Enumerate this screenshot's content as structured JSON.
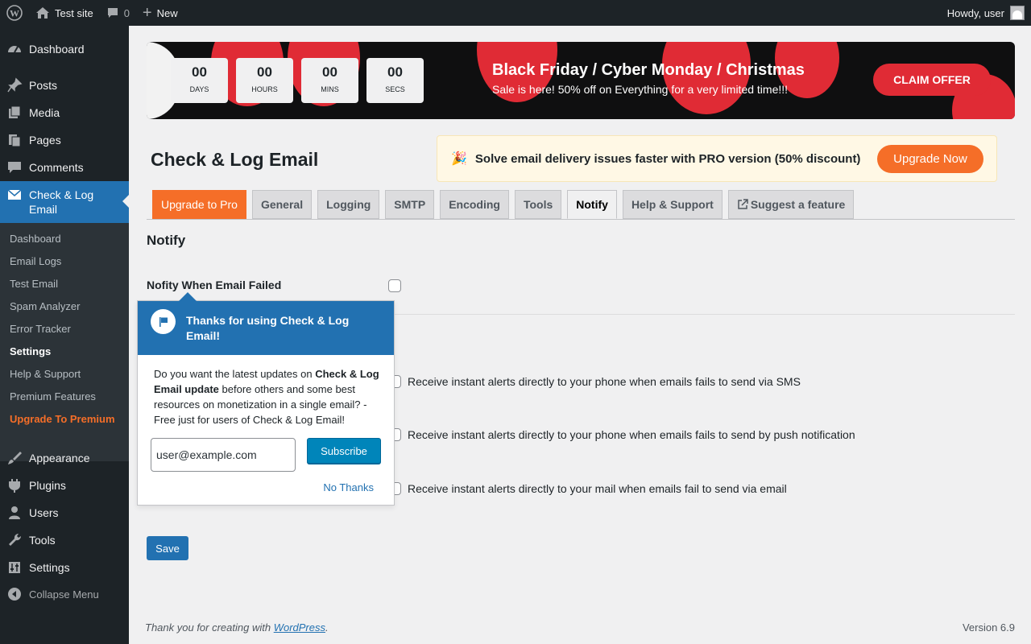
{
  "admin_bar": {
    "site_name": "Test site",
    "comments_count": "0",
    "new_label": "New",
    "howdy": "Howdy, user"
  },
  "sidebar": {
    "items": [
      {
        "label": "Dashboard",
        "icon": "dashboard-icon"
      },
      {
        "label": "Posts",
        "icon": "pin-icon"
      },
      {
        "label": "Media",
        "icon": "media-icon"
      },
      {
        "label": "Pages",
        "icon": "pages-icon"
      },
      {
        "label": "Comments",
        "icon": "comment-icon"
      },
      {
        "label": "Check & Log Email",
        "icon": "email-icon"
      },
      {
        "label": "Appearance",
        "icon": "brush-icon"
      },
      {
        "label": "Plugins",
        "icon": "plugin-icon"
      },
      {
        "label": "Users",
        "icon": "user-icon"
      },
      {
        "label": "Tools",
        "icon": "wrench-icon"
      },
      {
        "label": "Settings",
        "icon": "settings-icon"
      }
    ],
    "submenu": [
      "Dashboard",
      "Email Logs",
      "Test Email",
      "Spam Analyzer",
      "Error Tracker",
      "Settings",
      "Help & Support",
      "Premium Features",
      "Upgrade To Premium"
    ],
    "collapse_label": "Collapse Menu"
  },
  "banner": {
    "countdown": [
      {
        "value": "00",
        "label": "DAYS"
      },
      {
        "value": "00",
        "label": "HOURS"
      },
      {
        "value": "00",
        "label": "MINS"
      },
      {
        "value": "00",
        "label": "SECS"
      }
    ],
    "title": "Black Friday / Cyber Monday / Christmas",
    "subtitle": "Sale is here! 50% off on Everything for a very limited time!!!",
    "cta": "CLAIM OFFER",
    "accent_color": "#e02b35"
  },
  "page": {
    "title": "Check & Log Email"
  },
  "pro_notice": {
    "emoji": "🎉",
    "text": "Solve email delivery issues faster with PRO version (50% discount)",
    "button": "Upgrade Now"
  },
  "tabs": [
    "Upgrade to Pro",
    "General",
    "Logging",
    "SMTP",
    "Encoding",
    "Tools",
    "Notify",
    "Help & Support",
    "Suggest a feature"
  ],
  "notify": {
    "section_title": "Notify",
    "field_label": "Nofity When Email Failed",
    "options": [
      "Receive instant alerts directly to your phone when emails fails to send via SMS",
      "Receive instant alerts directly to your phone when emails fails to send by push notification",
      "Receive instant alerts directly to your mail when emails fail to send via email"
    ],
    "save_label": "Save"
  },
  "pointer": {
    "title": "Thanks for using Check & Log Email!",
    "body_pre": "Do you want the latest updates on ",
    "body_bold": "Check & Log Email update",
    "body_post": " before others and some best resources on monetization in a single email? - Free just for users of Check & Log Email!",
    "email_value": "user@example.com",
    "subscribe_label": "Subscribe",
    "no_thanks_label": "No Thanks"
  },
  "footer": {
    "thanks_pre": "Thank you for creating with ",
    "thanks_link": "WordPress",
    "thanks_post": ".",
    "version": "Version 6.9"
  }
}
